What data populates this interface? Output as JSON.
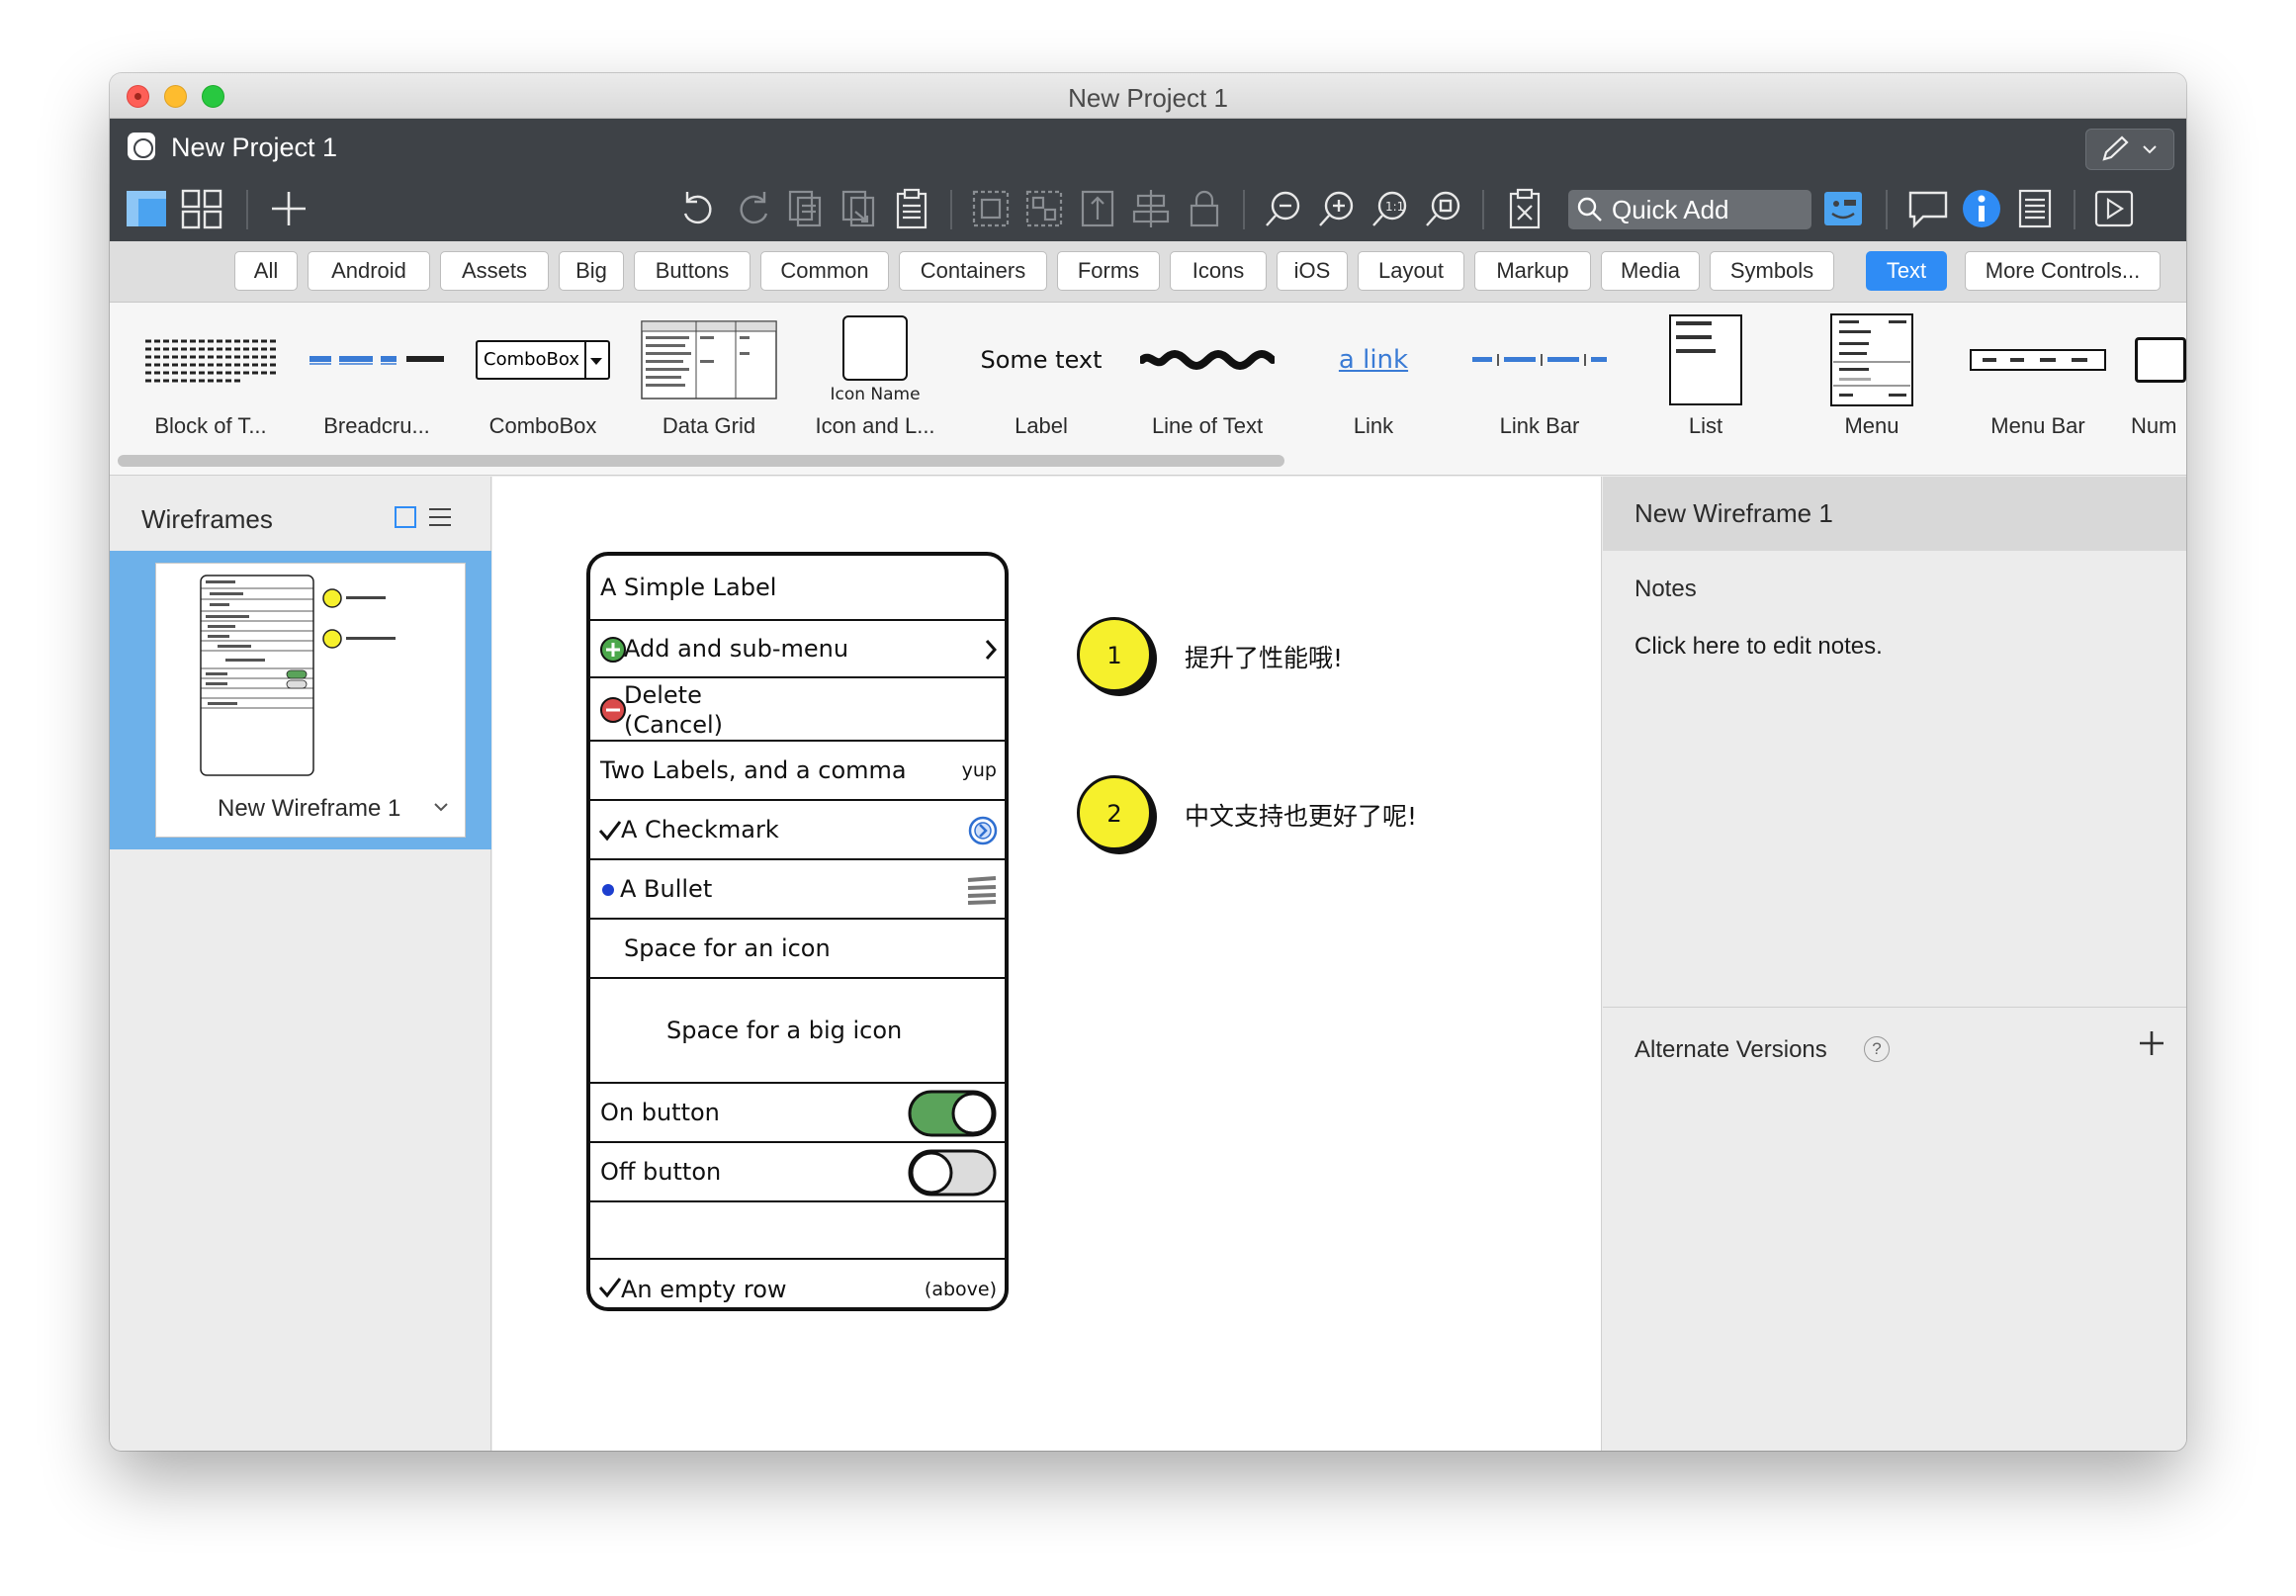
{
  "window": {
    "title": "New Project 1"
  },
  "appbar": {
    "project_title": "New Project 1",
    "quick_add_placeholder": "Quick Add"
  },
  "filters": [
    {
      "label": "All",
      "active": false
    },
    {
      "label": "Android",
      "active": false
    },
    {
      "label": "Assets",
      "active": false
    },
    {
      "label": "Big",
      "active": false
    },
    {
      "label": "Buttons",
      "active": false
    },
    {
      "label": "Common",
      "active": false
    },
    {
      "label": "Containers",
      "active": false
    },
    {
      "label": "Forms",
      "active": false
    },
    {
      "label": "Icons",
      "active": false
    },
    {
      "label": "iOS",
      "active": false
    },
    {
      "label": "Layout",
      "active": false
    },
    {
      "label": "Markup",
      "active": false
    },
    {
      "label": "Media",
      "active": false
    },
    {
      "label": "Symbols",
      "active": false
    },
    {
      "label": "Text",
      "active": true
    },
    {
      "label": "More Controls...",
      "active": false
    }
  ],
  "controls": [
    {
      "label": "Block of T..."
    },
    {
      "label": "Breadcru..."
    },
    {
      "label": "ComboBox",
      "thumb_text": "ComboBox"
    },
    {
      "label": "Data Grid"
    },
    {
      "label": "Icon and L...",
      "thumb_text": "Icon Name"
    },
    {
      "label": "Label",
      "thumb_text": "Some text"
    },
    {
      "label": "Line of Text"
    },
    {
      "label": "Link",
      "thumb_text": "a link"
    },
    {
      "label": "Link Bar"
    },
    {
      "label": "List"
    },
    {
      "label": "Menu"
    },
    {
      "label": "Menu Bar"
    },
    {
      "label": "Num"
    }
  ],
  "left_panel": {
    "title": "Wireframes",
    "wireframe_name": "New Wireframe 1"
  },
  "mockup": {
    "rows": {
      "simple_label": "A Simple Label",
      "add_submenu": "Add and sub-menu",
      "delete": "Delete",
      "cancel": "(Cancel)",
      "two_labels": "Two Labels, and a comma",
      "two_labels_right": "yup",
      "checkmark": "A Checkmark",
      "bullet": "A Bullet",
      "space_icon": "Space for an icon",
      "space_big_icon": "Space for a big icon",
      "on_button": "On button",
      "off_button": "Off button",
      "empty_row": "An empty row",
      "empty_row_right": "(above)"
    },
    "callouts": [
      {
        "number": "1",
        "text": "提升了性能哦!"
      },
      {
        "number": "2",
        "text": "中文支持也更好了呢!"
      }
    ]
  },
  "right_panel": {
    "title": "New Wireframe 1",
    "notes_label": "Notes",
    "notes_text": "Click here to edit notes.",
    "alternate_versions": "Alternate Versions",
    "help": "?"
  },
  "colors": {
    "accent": "#2f8cf5",
    "appbar": "#3e4247",
    "selection": "#6db1ea",
    "callout": "#f6f02c",
    "toggle_on": "#5aa35a"
  }
}
